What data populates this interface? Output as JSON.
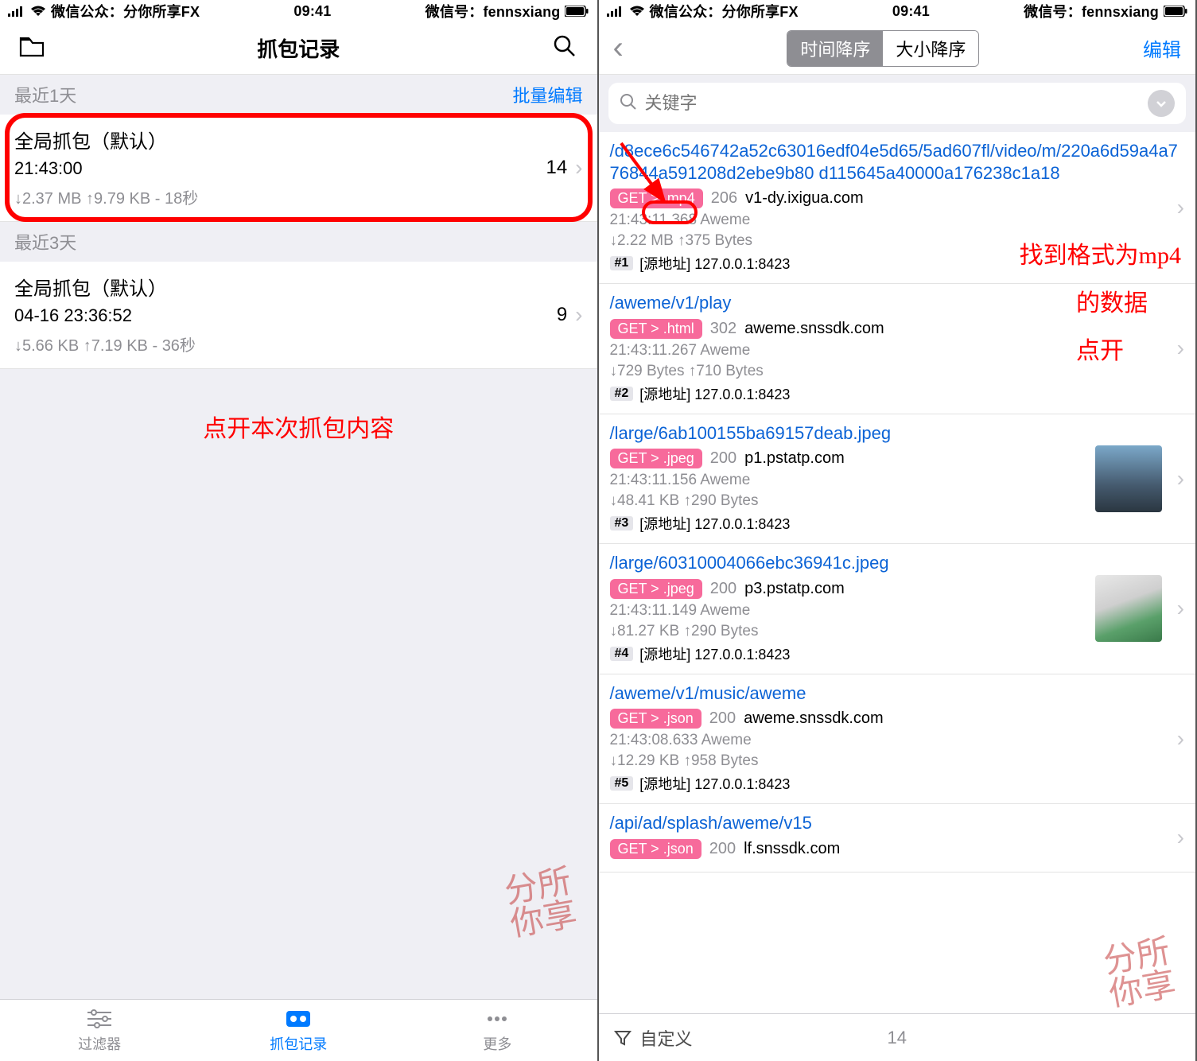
{
  "status_bar": {
    "left_text": "微信公众：分你所享FX",
    "time": "09:41",
    "right_text": "微信号：fennsxiang"
  },
  "left": {
    "nav_title": "抓包记录",
    "section1_label": "最近1天",
    "section1_action": "批量编辑",
    "row1": {
      "title": "全局抓包（默认）",
      "time": "21:43:00",
      "down": "2.37 MB",
      "up": "9.79 KB",
      "dur": "18秒",
      "count": "14"
    },
    "section2_label": "最近3天",
    "row2": {
      "title": "全局抓包（默认）",
      "time": "04-16 23:36:52",
      "down": "5.66 KB",
      "up": "7.19 KB",
      "dur": "36秒",
      "count": "9"
    },
    "annotation": "点开本次抓包内容",
    "tabs": {
      "filter": "过滤器",
      "records": "抓包记录",
      "more": "更多"
    },
    "watermark": "分所\n你享"
  },
  "right": {
    "seg_time": "时间降序",
    "seg_size": "大小降序",
    "edit": "编辑",
    "search_placeholder": "关键字",
    "reqs": [
      {
        "url": "/d8ece6c546742a52c63016edf04e5d65/5ad607fl/video/m/220a6d59a4a776844a591208d2ebe9b80  d115645a40000a176238c1a18",
        "badge": "GET > .mp4",
        "code": "206",
        "host": "v1-dy.ixigua.com",
        "time": "21:43:11.368 Aweme",
        "down": "2.22 MB",
        "up": "375 Bytes",
        "idx": "#1",
        "src": "[源地址] 127.0.0.1:8423"
      },
      {
        "url": "/aweme/v1/play",
        "badge": "GET > .html",
        "code": "302",
        "host": "aweme.snssdk.com",
        "time": "21:43:11.267 Aweme",
        "down": "729 Bytes",
        "up": "710 Bytes",
        "idx": "#2",
        "src": "[源地址] 127.0.0.1:8423"
      },
      {
        "url": "/large/6ab100155ba69157deab.jpeg",
        "badge": "GET > .jpeg",
        "code": "200",
        "host": "p1.pstatp.com",
        "time": "21:43:11.156 Aweme",
        "down": "48.41 KB",
        "up": "290 Bytes",
        "idx": "#3",
        "src": "[源地址] 127.0.0.1:8423"
      },
      {
        "url": "/large/60310004066ebc36941c.jpeg",
        "badge": "GET > .jpeg",
        "code": "200",
        "host": "p3.pstatp.com",
        "time": "21:43:11.149 Aweme",
        "down": "81.27 KB",
        "up": "290 Bytes",
        "idx": "#4",
        "src": "[源地址] 127.0.0.1:8423"
      },
      {
        "url": "/aweme/v1/music/aweme",
        "badge": "GET > .json",
        "code": "200",
        "host": "aweme.snssdk.com",
        "time": "21:43:08.633 Aweme",
        "down": "12.29 KB",
        "up": "958 Bytes",
        "idx": "#5",
        "src": "[源地址] 127.0.0.1:8423"
      },
      {
        "url": "/api/ad/splash/aweme/v15",
        "badge": "GET > .json",
        "code": "200",
        "host": "lf.snssdk.com",
        "time": "",
        "down": "",
        "up": "",
        "idx": "",
        "src": ""
      }
    ],
    "annotation1": "找到格式为mp4",
    "annotation2": "的数据",
    "annotation3": "点开",
    "filter_label": "自定义",
    "bottom_count": "14",
    "watermark": "分所\n你享"
  }
}
